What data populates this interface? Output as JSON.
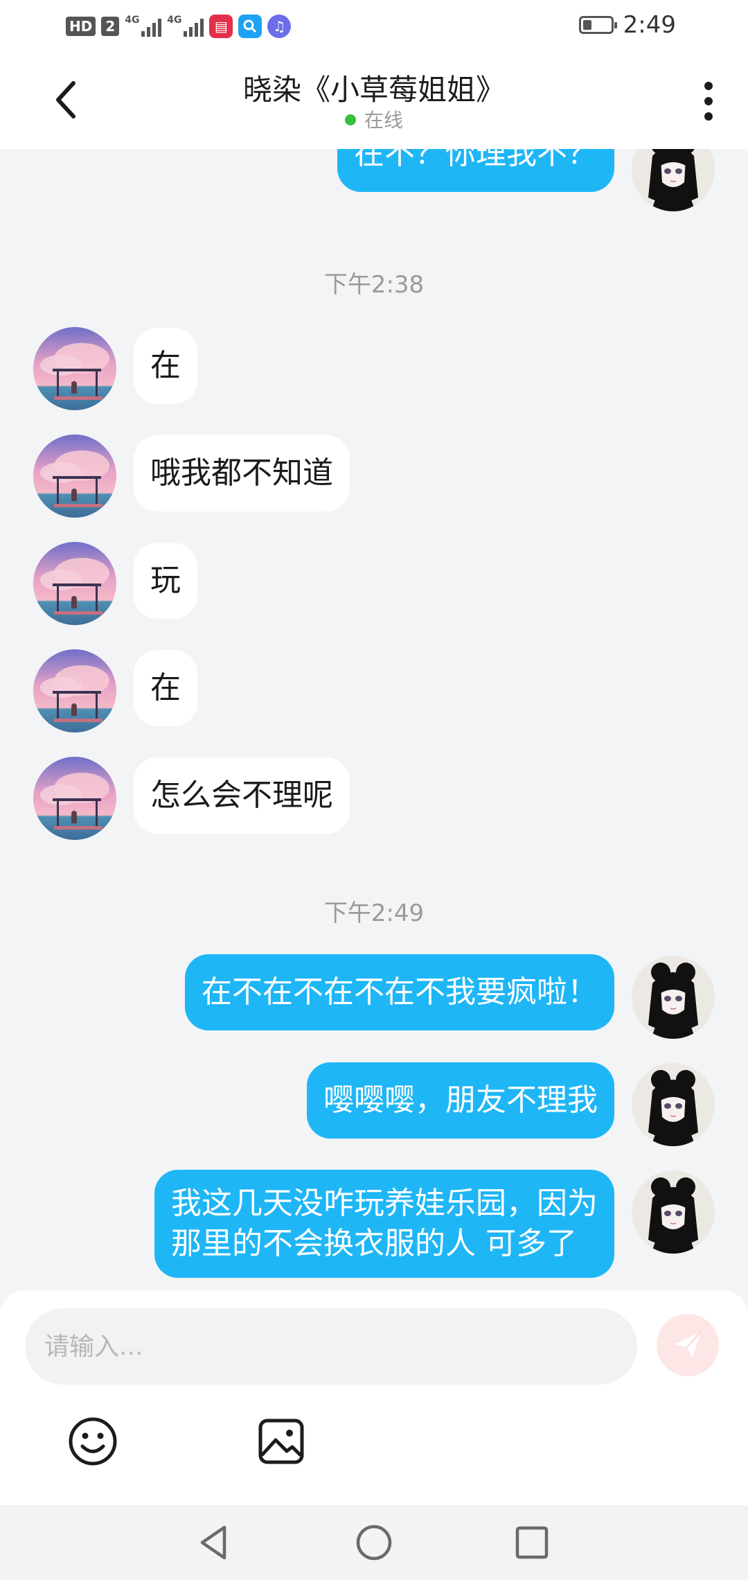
{
  "status_bar": {
    "hd_label": "HD",
    "sim_label": "2",
    "net1": "4G",
    "net2": "4G",
    "time": "2:49",
    "icons": [
      "book-app-icon",
      "search-app-icon",
      "music-app-icon"
    ]
  },
  "header": {
    "title": "晓染《小草莓姐姐》",
    "status": "在线"
  },
  "messages": {
    "m0": "在不？你理我不？",
    "ts1": "下午2:38",
    "m1": "在",
    "m2": "哦我都不知道",
    "m3": "玩",
    "m4": "在",
    "m5": "怎么会不理呢",
    "ts2": "下午2:49",
    "m6": "在不在不在不在不我要疯啦！",
    "m7": "嘤嘤嘤，朋友不理我",
    "m8_line1": "我这几天没咋玩养娃乐园，因为",
    "m8_line2": "那里的不会换衣服的人  可多了"
  },
  "input": {
    "placeholder": "请输入..."
  },
  "colors": {
    "outgoing_bubble": "#1fb6f6",
    "incoming_bubble": "#ffffff",
    "online_dot": "#37c03d",
    "background": "#f3f4f6"
  }
}
